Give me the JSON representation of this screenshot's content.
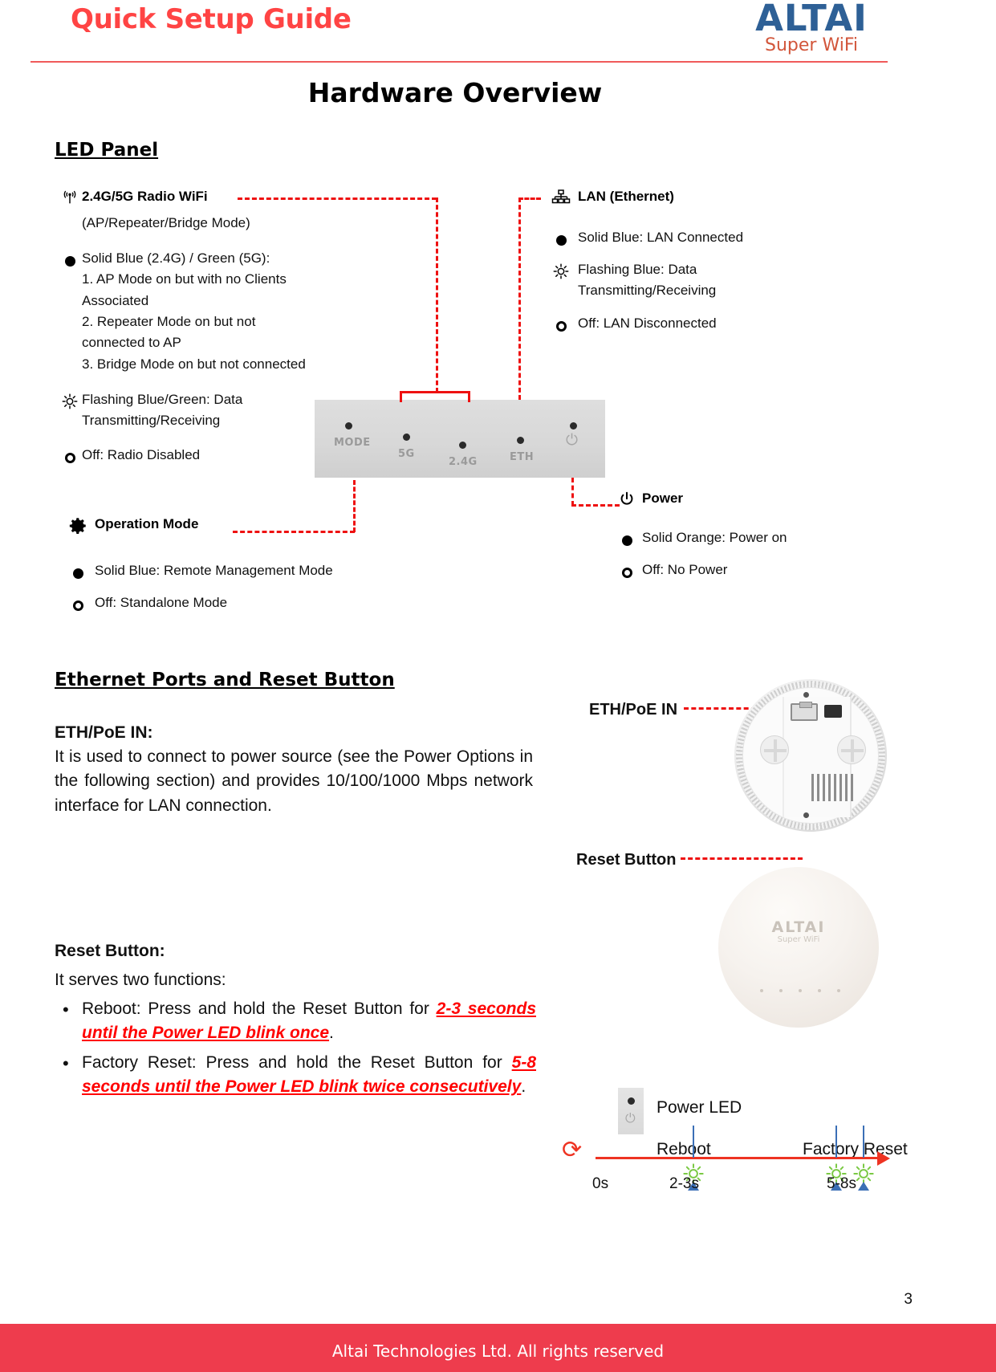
{
  "header": {
    "title": "Quick Setup Guide",
    "brand_name": "ALTAI",
    "brand_sub": "Super WiFi"
  },
  "page_title": "Hardware Overview",
  "sections": {
    "led_panel_heading": "LED Panel",
    "ethernet_heading": "Ethernet Ports and Reset Button"
  },
  "led_panel": {
    "radio": {
      "icon": "wifi-signal-icon",
      "title": "2.4G/5G Radio WiFi",
      "subtitle": "(AP/Repeater/Bridge Mode)",
      "states": [
        {
          "icon": "solid-dot-icon",
          "label": "Solid Blue (2.4G) / Green (5G):",
          "lines": [
            "1. AP Mode on but with no Clients",
            "Associated",
            "2. Repeater Mode on but not",
            "connected to AP",
            "3. Bridge Mode on but not connected"
          ]
        },
        {
          "icon": "flashing-sun-icon",
          "label": "Flashing Blue/Green: Data",
          "lines": [
            "Transmitting/Receiving"
          ]
        },
        {
          "icon": "hollow-dot-icon",
          "label": "Off: Radio Disabled",
          "lines": []
        }
      ]
    },
    "operation_mode": {
      "icon": "gear-icon",
      "title": "Operation Mode",
      "states": [
        {
          "icon": "solid-dot-icon",
          "label": "Solid Blue: Remote Management Mode"
        },
        {
          "icon": "hollow-dot-icon",
          "label": "Off: Standalone Mode"
        }
      ]
    },
    "lan": {
      "icon": "network-tree-icon",
      "title": "LAN (Ethernet)",
      "states": [
        {
          "icon": "solid-dot-icon",
          "label": "Solid Blue: LAN Connected"
        },
        {
          "icon": "flashing-sun-icon",
          "label": "Flashing Blue: Data",
          "line2": "Transmitting/Receiving"
        },
        {
          "icon": "hollow-dot-icon",
          "label": "Off: LAN Disconnected"
        }
      ]
    },
    "power": {
      "icon": "power-icon",
      "title": "Power",
      "states": [
        {
          "icon": "solid-dot-icon",
          "label": "Solid Orange: Power on"
        },
        {
          "icon": "hollow-dot-icon",
          "label": "Off: No Power"
        }
      ]
    },
    "device_strip": {
      "mode_label": "MODE",
      "label_5g": "5G",
      "label_24g": "2.4G",
      "label_eth": "ETH",
      "power_glyph": "power-icon"
    }
  },
  "ethernet_section": {
    "eth_title": "ETH/PoE IN:",
    "eth_body": "It is used to connect to power source (see the Power Options in the following section) and provides 10/100/1000 Mbps network interface for LAN connection.",
    "reset_title": "Reset Button:",
    "reset_intro": "It serves two functions:",
    "bullets": [
      {
        "pre": "Reboot: Press and hold the Reset Button for ",
        "em": "2-3 seconds until the Power LED blink once",
        "post": "."
      },
      {
        "pre": "Factory Reset: Press and hold the Reset Button for ",
        "em": "5-8 seconds until the Power LED blink twice consecutively",
        "post": "."
      }
    ],
    "callouts": {
      "eth_poe_in": "ETH/PoE IN",
      "reset_button": "Reset Button"
    },
    "device_top_logo": "ALTAI",
    "device_top_logo_sub": "Super WiFi"
  },
  "timeline": {
    "power_led_label": "Power LED",
    "reboot_label": "Reboot",
    "factory_reset_label": "Factory Reset",
    "ticks": [
      "0s",
      "2-3s",
      "5-8s"
    ],
    "blink_color": "#7AC943",
    "axis_color": "#EE3322",
    "arrow_color": "#3B6FB6"
  },
  "footer": {
    "page_number": "3",
    "copyright": "Altai Technologies Ltd. All rights reserved"
  }
}
